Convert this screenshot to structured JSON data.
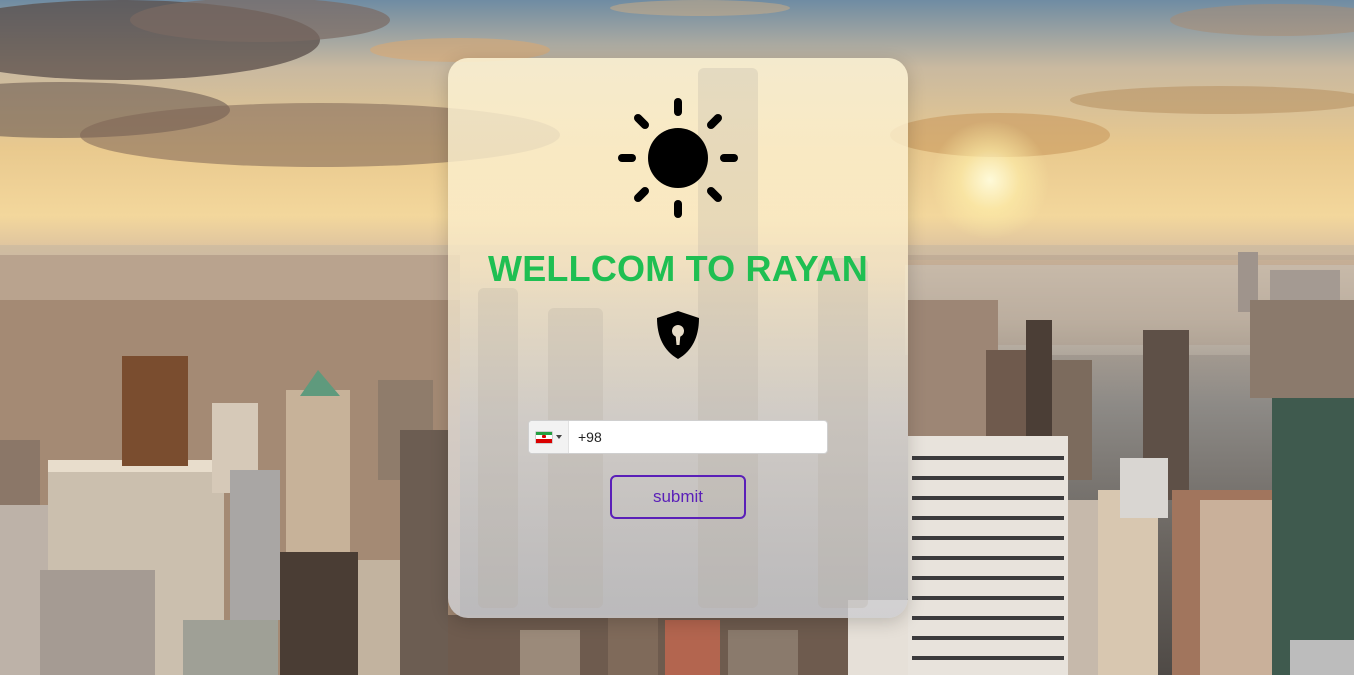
{
  "page": {
    "title": "WELLCOM TO RAYAN"
  },
  "phone": {
    "country_flag": "iran-flag-icon",
    "value": "+98"
  },
  "form": {
    "submit_label": "submit"
  },
  "icons": {
    "header": "sun-icon",
    "security": "shield-keyhole-icon"
  },
  "colors": {
    "title": "#1fbf52",
    "submit": "#5a1fb8"
  }
}
